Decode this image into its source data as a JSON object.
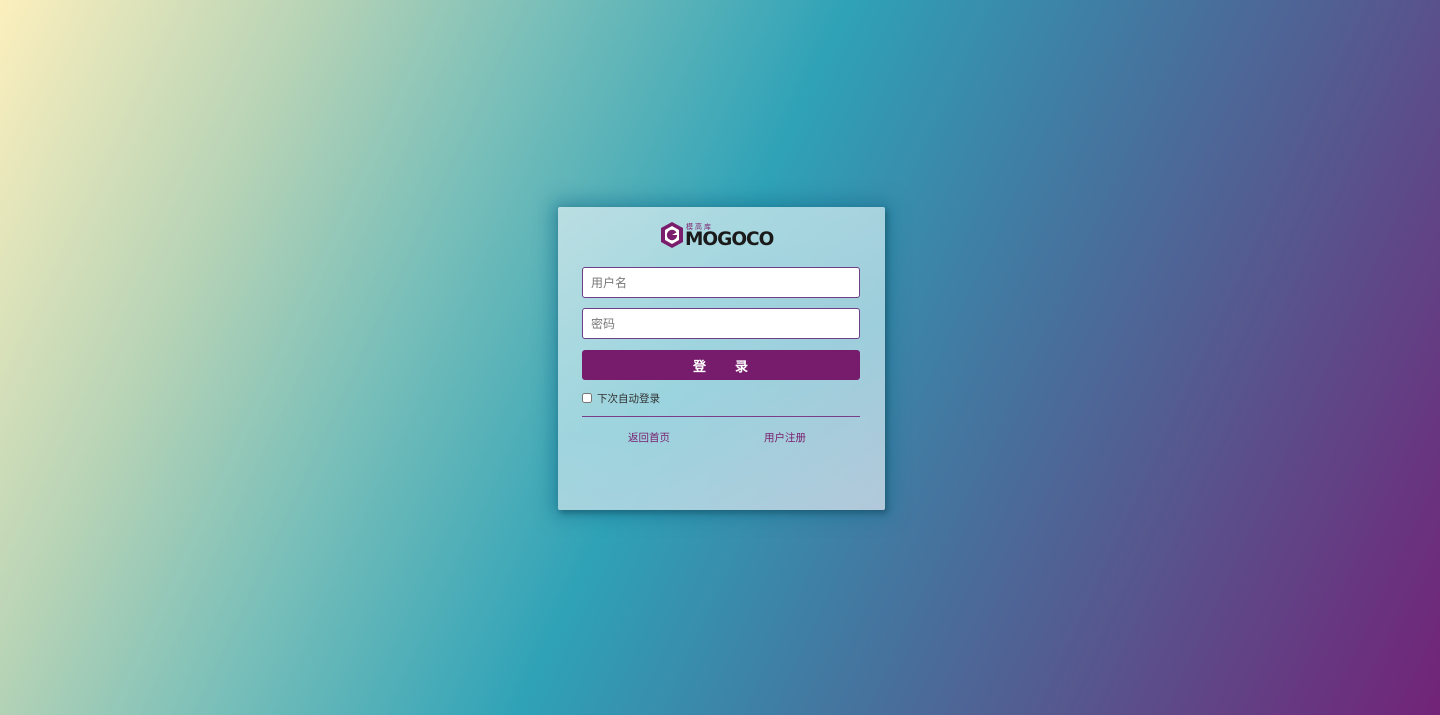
{
  "logo": {
    "small_text": "模高库",
    "word": "MOGOCO",
    "color": "#7a1d6c"
  },
  "form": {
    "username_placeholder": "用户名",
    "username_value": "",
    "password_placeholder": "密码",
    "password_value": "",
    "login_label": "登　　录",
    "remember_label": "下次自动登录",
    "remember_checked": false
  },
  "links": {
    "home": "返回首页",
    "register": "用户注册"
  },
  "colors": {
    "accent": "#771c6d",
    "gradient_start": "#fcefbd",
    "gradient_mid": "#2fa2b7",
    "gradient_end": "#722378"
  }
}
